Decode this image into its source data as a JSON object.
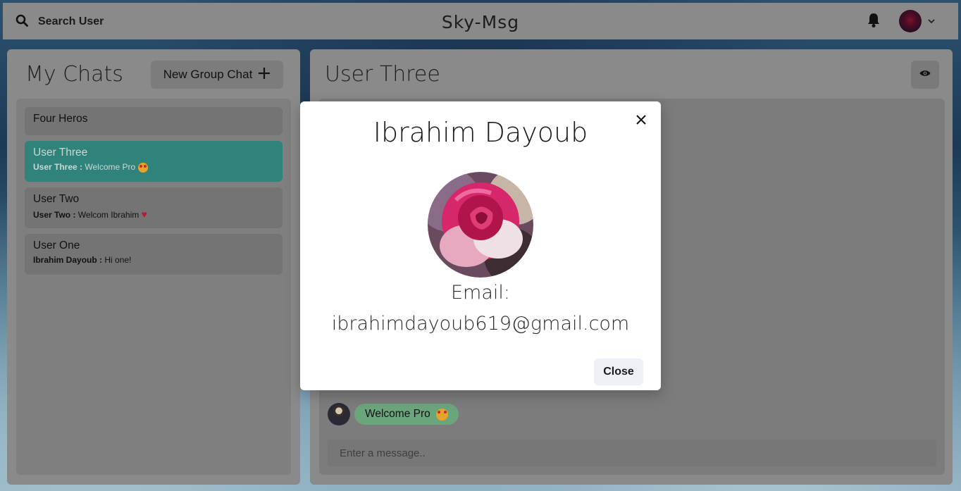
{
  "header": {
    "search_label": "Search User",
    "brand": "Sky-Msg"
  },
  "sidebar": {
    "title": "My Chats",
    "new_group_label": "New Group Chat",
    "chats": [
      {
        "name": "Four Heros",
        "sender": "",
        "message": ""
      },
      {
        "name": "User Three",
        "sender": "User Three :",
        "message": "Welcome Pro"
      },
      {
        "name": "User Two",
        "sender": "User Two :",
        "message": "Welcom Ibrahim"
      },
      {
        "name": "User One",
        "sender": "Ibrahim Dayoub :",
        "message": "Hi one!"
      }
    ]
  },
  "conversation": {
    "title": "User Three",
    "message_text": "Welcome Pro",
    "input_placeholder": "Enter a message.."
  },
  "modal": {
    "name": "Ibrahim Dayoub",
    "email_label": "Email:",
    "email": "ibrahimdayoub619@gmail.com",
    "close_label": "Close"
  },
  "colors": {
    "active_chat": "#2f837a",
    "bubble": "#6ba57c"
  },
  "icons": [
    "search-icon",
    "bell-icon",
    "chevron-down-icon",
    "plus-icon",
    "eye-icon",
    "close-icon"
  ]
}
